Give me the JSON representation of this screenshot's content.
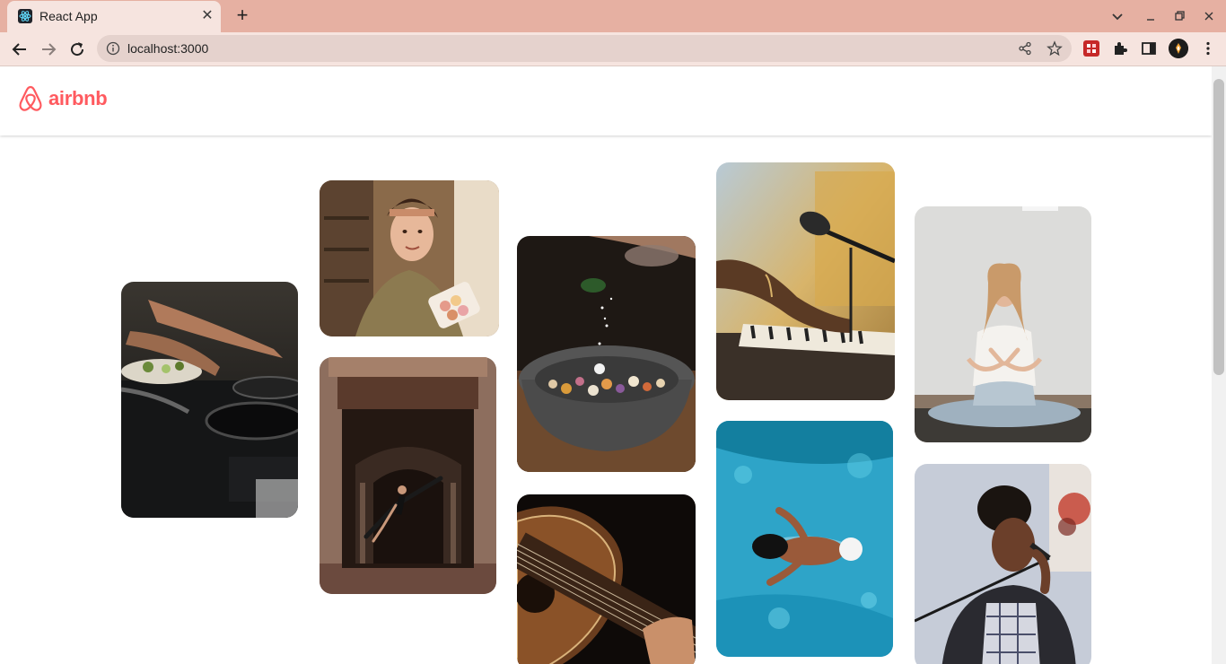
{
  "browser": {
    "tab_title": "React App",
    "url": "localhost:3000",
    "colors": {
      "tab_strip": "#e6b0a2",
      "toolbar": "#f6e4df",
      "omnibox": "#e5d2cd"
    }
  },
  "page": {
    "brand": "airbnb",
    "brand_color": "#ff5a5f",
    "gallery": [
      {
        "name": "cooking-pans-photo",
        "subject": "cooking"
      },
      {
        "name": "macarons-baker-photo",
        "subject": "baking"
      },
      {
        "name": "dancer-archway-photo",
        "subject": "dance"
      },
      {
        "name": "salt-bowl-photo",
        "subject": "food"
      },
      {
        "name": "guitar-photo",
        "subject": "guitar"
      },
      {
        "name": "piano-microphone-photo",
        "subject": "music"
      },
      {
        "name": "swimmer-photo",
        "subject": "swimming"
      },
      {
        "name": "yoga-photo",
        "subject": "yoga"
      },
      {
        "name": "singer-photo",
        "subject": "singing"
      }
    ]
  }
}
